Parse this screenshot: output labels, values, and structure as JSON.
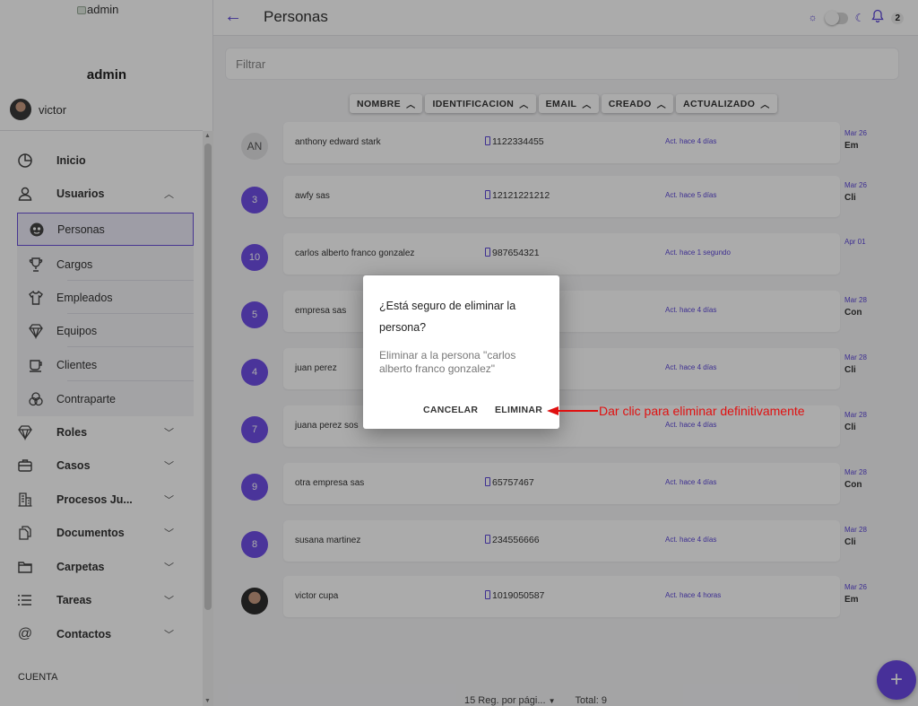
{
  "sidebar": {
    "logo_alt": "admin",
    "username": "admin",
    "current_user": "victor",
    "footer": "CUENTA",
    "items": [
      {
        "label": "Inicio",
        "icon": "dashboard-icon"
      },
      {
        "label": "Usuarios",
        "icon": "user-icon"
      },
      {
        "label": "Roles",
        "icon": "roles-icon"
      },
      {
        "label": "Casos",
        "icon": "briefcase-icon"
      },
      {
        "label": "Procesos Ju...",
        "icon": "building-icon"
      },
      {
        "label": "Documentos",
        "icon": "documents-icon"
      },
      {
        "label": "Carpetas",
        "icon": "folder-icon"
      },
      {
        "label": "Tareas",
        "icon": "list-icon"
      },
      {
        "label": "Contactos",
        "icon": "at-icon"
      }
    ],
    "subitems": [
      {
        "label": "Personas",
        "icon": "face-icon",
        "active": true
      },
      {
        "label": "Cargos",
        "icon": "trophy-icon"
      },
      {
        "label": "Empleados",
        "icon": "shirt-icon"
      },
      {
        "label": "Equipos",
        "icon": "diamond-icon"
      },
      {
        "label": "Clientes",
        "icon": "cup-icon"
      },
      {
        "label": "Contraparte",
        "icon": "circles-icon"
      }
    ]
  },
  "header": {
    "title": "Personas",
    "notification_count": "2"
  },
  "filter": {
    "placeholder": "Filtrar"
  },
  "sort_columns": [
    "NOMBRE",
    "IDENTIFICACION",
    "EMAIL",
    "CREADO",
    "ACTUALIZADO"
  ],
  "rows": [
    {
      "avatar": "AN",
      "name": "anthony edward stark",
      "id": "1122334455",
      "updated": "Act. hace 4 días",
      "date": "Mar 26",
      "type": "Em"
    },
    {
      "avatar": "3",
      "name": "awfy sas",
      "id": "12121221212",
      "updated": "Act. hace 5 días",
      "date": "Mar 26",
      "type": "Cli"
    },
    {
      "avatar": "10",
      "name": "carlos alberto franco gonzalez",
      "id": "987654321",
      "updated": "Act. hace 1 segundo",
      "date": "Apr 01",
      "type": ""
    },
    {
      "avatar": "5",
      "name": "empresa sas",
      "id": "",
      "updated": "Act. hace 4 días",
      "date": "Mar 28",
      "type": "Con"
    },
    {
      "avatar": "4",
      "name": "juan perez",
      "id": "",
      "updated": "Act. hace 4 días",
      "date": "Mar 28",
      "type": "Cli"
    },
    {
      "avatar": "7",
      "name": "juana perez sos",
      "id": "",
      "updated": "Act. hace 4 días",
      "date": "Mar 28",
      "type": "Cli"
    },
    {
      "avatar": "9",
      "name": "otra empresa sas",
      "id": "65757467",
      "updated": "Act. hace 4 días",
      "date": "Mar 28",
      "type": "Con"
    },
    {
      "avatar": "8",
      "name": "susana martinez",
      "id": "234556666",
      "updated": "Act. hace 4 días",
      "date": "Mar 28",
      "type": "Cli"
    },
    {
      "avatar": "",
      "name": "victor cupa",
      "id": "1019050587",
      "updated": "Act. hace 4 horas",
      "date": "Mar 26",
      "type": "Em"
    }
  ],
  "pagination": {
    "per_page": "15 Reg. por pági...",
    "total": "Total: 9"
  },
  "fab": {
    "label": "+"
  },
  "dialog": {
    "title": "¿Está seguro de eliminar la persona?",
    "body": "Eliminar a la persona \"carlos alberto franco gonzalez\"",
    "cancel": "CANCELAR",
    "confirm": "ELIMINAR"
  },
  "annotation": {
    "text": "Dar clic para eliminar definitivamente",
    "color": "#e01010"
  },
  "colors": {
    "accent": "#6a48e5",
    "link": "#5c46d9"
  }
}
